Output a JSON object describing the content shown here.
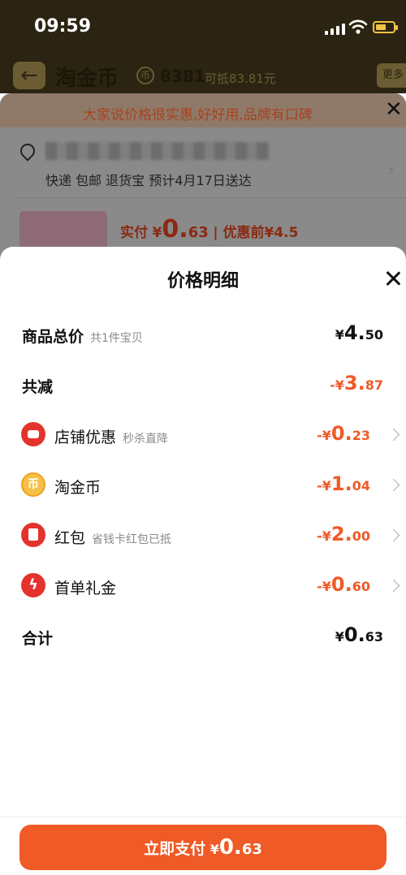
{
  "status_bar": {
    "time": "09:59"
  },
  "background": {
    "title": "淘金币",
    "coin_count": "8381",
    "coin_deduct": "可抵83.81元",
    "more": "更多",
    "banner": "大家说价格很实惠,好好用,品牌有口碑",
    "delivery": "快递 包邮 退货宝 预计4月17日送达",
    "paid_label": "实付",
    "paid_symbol": "¥",
    "paid_int": "0.",
    "paid_dec": "63",
    "before_discount": "优惠前¥4.5"
  },
  "modal": {
    "title": "价格明细",
    "rows": [
      {
        "label": "商品总价",
        "sub": "共1件宝贝",
        "symbol": "¥",
        "int": "4.",
        "dec": "50"
      },
      {
        "label": "共减",
        "symbol": "-¥",
        "int": "3.",
        "dec": "87"
      },
      {
        "label": "店铺优惠",
        "sub": "秒杀直降",
        "symbol": "-¥",
        "int": "0.",
        "dec": "23",
        "icon": "store-icon"
      },
      {
        "label": "淘金币",
        "symbol": "-¥",
        "int": "1.",
        "dec": "04",
        "icon": "coin-icon"
      },
      {
        "label": "红包",
        "sub": "省钱卡红包已抵",
        "symbol": "-¥",
        "int": "2.",
        "dec": "00",
        "icon": "red-packet-icon"
      },
      {
        "label": "首单礼金",
        "symbol": "-¥",
        "int": "0.",
        "dec": "60",
        "icon": "lightning-icon"
      },
      {
        "label": "合计",
        "symbol": "¥",
        "int": "0.",
        "dec": "63"
      }
    ]
  },
  "pay_button": {
    "label": "立即支付",
    "symbol": "¥",
    "int": "0.",
    "dec": "63"
  },
  "colors": {
    "accent": "#ef5a26",
    "icon_red": "#e4322d",
    "coin": "#f5c04a"
  }
}
